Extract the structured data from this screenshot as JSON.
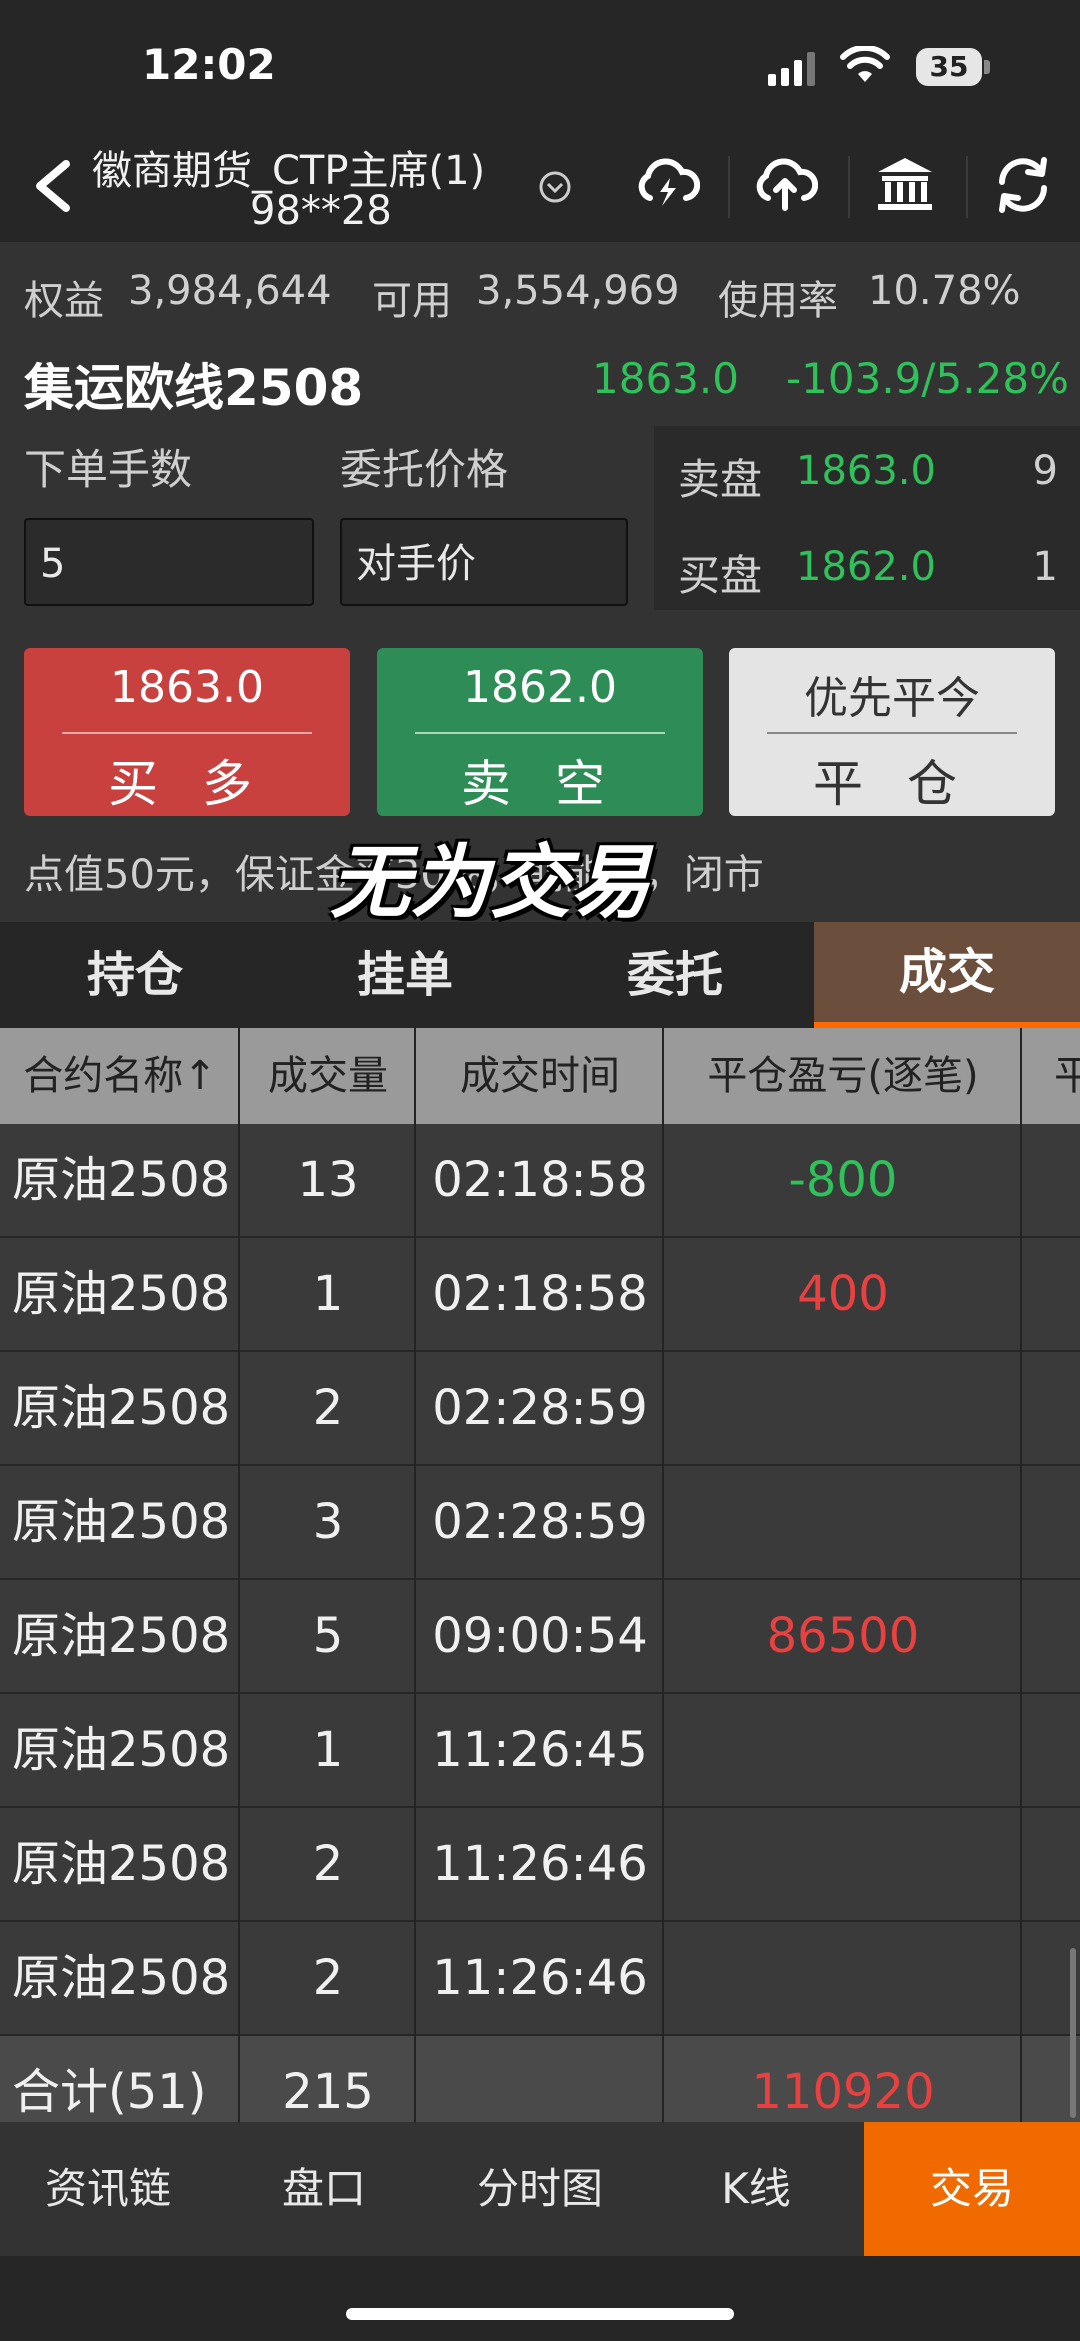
{
  "status_bar": {
    "time": "12:02",
    "battery": "35"
  },
  "nav": {
    "title": "徽商期货_CTP主席(1)",
    "subtitle": "98**28",
    "icons": [
      "cloud-lightning-icon",
      "cloud-upload-icon",
      "bank-icon",
      "refresh-icon"
    ]
  },
  "account": {
    "equity_label": "权益",
    "equity": "3,984,644",
    "available_label": "可用",
    "available": "3,554,969",
    "usage_label": "使用率",
    "usage": "10.78%"
  },
  "instrument": {
    "name": "集运欧线2508",
    "price": "1863.0",
    "change": "-103.9/5.28%"
  },
  "order": {
    "qty_label": "下单手数",
    "qty_value": "5",
    "price_label": "委托价格",
    "price_value": "对手价",
    "ask_label": "卖盘",
    "ask_price": "1863.0",
    "ask_qty": "9",
    "bid_label": "买盘",
    "bid_price": "1862.0",
    "bid_qty": "1"
  },
  "buttons": {
    "buy_price": "1863.0",
    "buy_label": "买 多",
    "sell_price": "1862.0",
    "sell_label": "卖 空",
    "close_top": "优先平今",
    "close_label": "平 仓"
  },
  "info_text": "点值50元，保证金率30%，期能源，闭市",
  "overlay_text": "无为交易",
  "tabs": [
    {
      "label": "持仓"
    },
    {
      "label": "挂单"
    },
    {
      "label": "委托"
    },
    {
      "label": "成交",
      "active": true
    }
  ],
  "table": {
    "headers": [
      "合约名称↑",
      "成交量",
      "成交时间",
      "平仓盈亏(逐笔)",
      "平"
    ],
    "rows": [
      {
        "name": "原油2508",
        "volume": "13",
        "time": "02:18:58",
        "pnl": "-800",
        "pnl_color": "green"
      },
      {
        "name": "原油2508",
        "volume": "1",
        "time": "02:18:58",
        "pnl": "400",
        "pnl_color": "red"
      },
      {
        "name": "原油2508",
        "volume": "2",
        "time": "02:28:59",
        "pnl": "",
        "pnl_color": ""
      },
      {
        "name": "原油2508",
        "volume": "3",
        "time": "02:28:59",
        "pnl": "",
        "pnl_color": ""
      },
      {
        "name": "原油2508",
        "volume": "5",
        "time": "09:00:54",
        "pnl": "86500",
        "pnl_color": "red"
      },
      {
        "name": "原油2508",
        "volume": "1",
        "time": "11:26:45",
        "pnl": "",
        "pnl_color": ""
      },
      {
        "name": "原油2508",
        "volume": "2",
        "time": "11:26:46",
        "pnl": "",
        "pnl_color": ""
      },
      {
        "name": "原油2508",
        "volume": "2",
        "time": "11:26:46",
        "pnl": "",
        "pnl_color": ""
      }
    ],
    "total": {
      "name": "合计(51)",
      "volume": "215",
      "pnl": "110920"
    }
  },
  "bottom_nav": [
    {
      "label": "资讯链"
    },
    {
      "label": "盘口"
    },
    {
      "label": "分时图"
    },
    {
      "label": "K线"
    },
    {
      "label": "交易",
      "active": true
    }
  ],
  "colors": {
    "up": "#e8413f",
    "down": "#2fc15a",
    "accent": "#f06a00",
    "buy": "#c8413f",
    "sell": "#2e8d56"
  }
}
